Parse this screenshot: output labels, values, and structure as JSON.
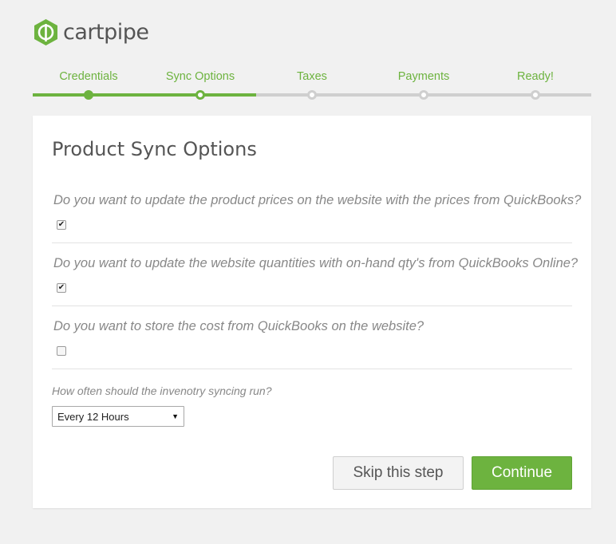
{
  "brand": {
    "name": "cartpipe",
    "logo_icon": "cartpipe-hexagon-logo",
    "accent_color": "#6db33f"
  },
  "steps": [
    {
      "label": "Credentials",
      "state": "done"
    },
    {
      "label": "Sync Options",
      "state": "current"
    },
    {
      "label": "Taxes",
      "state": "pending"
    },
    {
      "label": "Payments",
      "state": "pending"
    },
    {
      "label": "Ready!",
      "state": "pending"
    }
  ],
  "card": {
    "title": "Product Sync Options",
    "questions": [
      {
        "text": "Do you want to update the product prices on the website with the prices from QuickBooks?",
        "checked": true
      },
      {
        "text": "Do you want to update the website quantities with on-hand qty's from QuickBooks Online?",
        "checked": true
      },
      {
        "text": "Do you want to store the cost from QuickBooks on the website?",
        "checked": false
      }
    ],
    "frequency": {
      "label": "How often should the invenotry syncing run?",
      "selected": "Every 12 Hours"
    },
    "buttons": {
      "skip": "Skip this step",
      "continue": "Continue"
    }
  }
}
